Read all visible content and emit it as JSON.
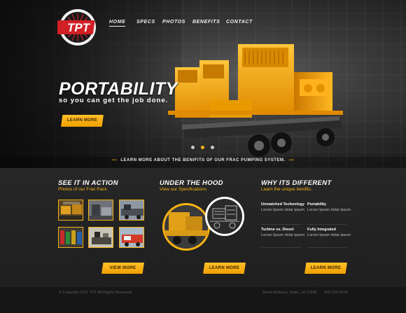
{
  "brand": {
    "logo_text": "TPT"
  },
  "nav": {
    "items": [
      {
        "label": "HOME",
        "active": true
      },
      {
        "label": "SPECS",
        "active": false
      },
      {
        "label": "PHOTOS",
        "active": false
      },
      {
        "label": "BENEFITS",
        "active": false
      },
      {
        "label": "CONTACT",
        "active": false
      }
    ]
  },
  "hero": {
    "headline": "PORTABILITY",
    "subline": "so you can get the job done.",
    "button_label": "LEARN MORE",
    "slides_total": 3,
    "slide_active": 2
  },
  "strip": {
    "left_chevrons": "‹‹‹",
    "text": "LEARN MORE ABOUT THE BENIFITS OF OUR FRAC PUMPING SYSTEM.",
    "right_chevrons": "›››"
  },
  "columns": {
    "action": {
      "title": "SEE IT IN ACTION",
      "subtitle": "Photos of our Frac Pack",
      "button_label": "VIEW MORE"
    },
    "hood": {
      "title": "UNDER THE HOOD",
      "subtitle": "View our Specifications",
      "button_label": "LEARN MORE"
    },
    "different": {
      "title": "WHY ITS DIFFERENT",
      "subtitle": "Learn the unique benifits.",
      "items": [
        {
          "title": "Unmatched Technology",
          "body": "Lorum Ipsum dolar ipsum"
        },
        {
          "title": "Portability",
          "body": "Lorum Ipsum dolar ipsum"
        },
        {
          "title": "Turbine vs. Diesel",
          "body": "Lorum Ipsum dolar ipsum"
        },
        {
          "title": "Fully Integrated",
          "body": "Lorum Ipsum dolar ipsum"
        }
      ],
      "button_label": "LEARN MORE"
    }
  },
  "footer": {
    "copyright": "© Copyright 2011 TPT All Rights Reserved",
    "address": "Street Address, State, LA 12345",
    "phone": "150-123-4578"
  },
  "colors": {
    "accent": "#f5b312",
    "logo_red": "#d11f26",
    "background": "#1b1b1b"
  }
}
